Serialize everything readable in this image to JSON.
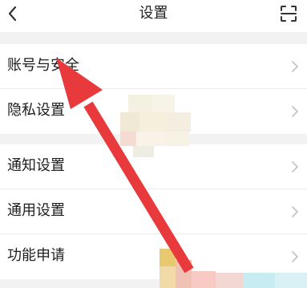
{
  "header": {
    "title": "设置"
  },
  "sections": [
    {
      "items": [
        {
          "label": "账号与安全"
        },
        {
          "label": "隐私设置"
        }
      ]
    },
    {
      "items": [
        {
          "label": "通知设置"
        },
        {
          "label": "通用设置"
        },
        {
          "label": "功能申请"
        }
      ]
    }
  ],
  "colors": {
    "background": "#f2f2f2",
    "surface": "#ffffff",
    "annotation_arrow": "#e8393d",
    "chevron": "#c4c4c4"
  },
  "icons": {
    "back": "chevron-left-icon",
    "scan": "scan-icon",
    "row_chevron": "chevron-right-icon"
  }
}
